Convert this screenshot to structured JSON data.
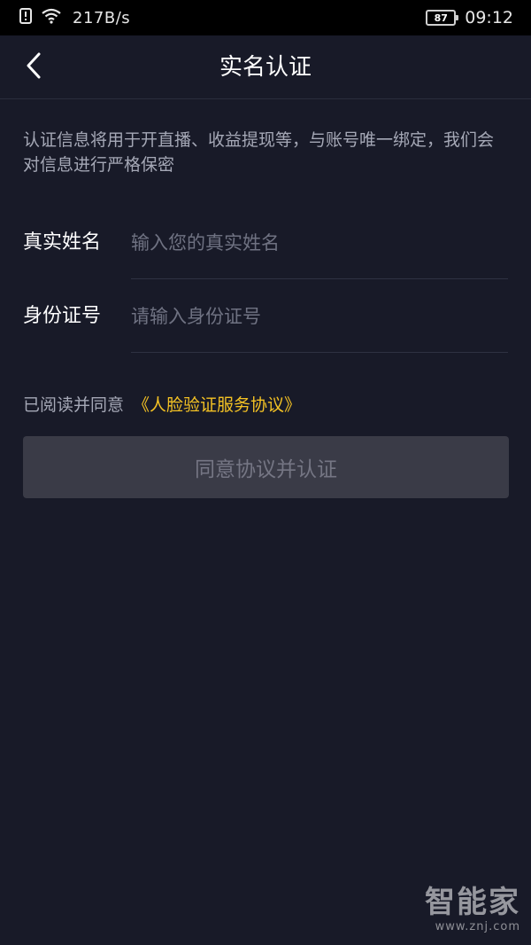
{
  "status_bar": {
    "speed": "217B/s",
    "battery": "87",
    "time": "09:12",
    "icons": [
      "alert-icon",
      "wifi-icon",
      "battery-icon"
    ]
  },
  "nav": {
    "title": "实名认证",
    "back_icon": "chevron-left-icon"
  },
  "description": "认证信息将用于开直播、收益提现等，与账号唯一绑定，我们会对信息进行严格保密",
  "form": {
    "name": {
      "label": "真实姓名",
      "placeholder": "输入您的真实姓名",
      "value": ""
    },
    "id": {
      "label": "身份证号",
      "placeholder": "请输入身份证号",
      "value": ""
    }
  },
  "agreement": {
    "prefix": "已阅读并同意",
    "link": "《人脸验证服务协议》"
  },
  "submit_label": "同意协议并认证",
  "watermark": {
    "brand": "智能家",
    "url": "www.znj.com"
  },
  "colors": {
    "background": "#181a28",
    "status_bar": "#000000",
    "link": "#f4c224",
    "button_disabled": "#3a3b47",
    "button_text": "#757684",
    "secondary_text": "#a5a8b6"
  }
}
